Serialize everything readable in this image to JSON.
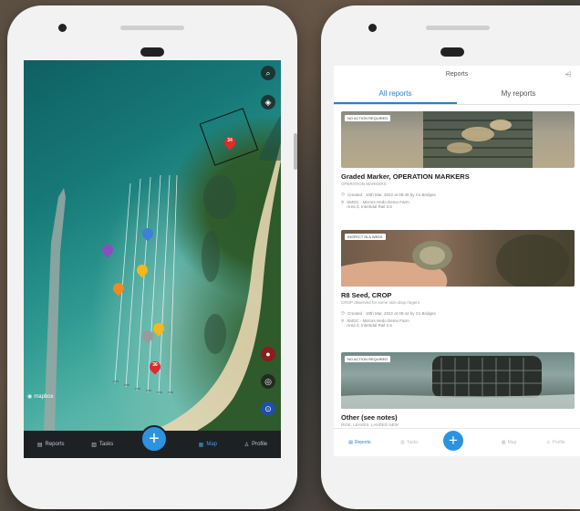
{
  "left_phone": {
    "tabs": [
      {
        "label": "Reports",
        "icon": "document-icon",
        "active": false
      },
      {
        "label": "Tasks",
        "icon": "clipboard-icon",
        "active": false
      },
      {
        "label": "Map",
        "icon": "map-icon",
        "active": true
      },
      {
        "label": "Profile",
        "icon": "person-icon",
        "active": false
      }
    ],
    "fab_label": "+",
    "attribution": "mapbox",
    "pins": [
      {
        "label": "34",
        "color": "#e02b2b"
      },
      {
        "label": "",
        "color": "#8a4fbf"
      },
      {
        "label": "",
        "color": "#3f7fd6"
      },
      {
        "label": "",
        "color": "#f3b81a"
      },
      {
        "label": "",
        "color": "#f08a1e"
      },
      {
        "label": "",
        "color": "#f3b81a"
      },
      {
        "label": "",
        "color": "#9a9a9a"
      },
      {
        "label": "36",
        "color": "#e02b2b"
      }
    ]
  },
  "right_phone": {
    "header_title": "Reports",
    "tabs": [
      {
        "label": "All reports",
        "active": true
      },
      {
        "label": "My reports",
        "active": false
      }
    ],
    "reports": [
      {
        "badge": "NO ACTION REQUIRED",
        "title": "Graded Marker, OPERATION MARKERS",
        "subtitle": "OPERATION MARKERS",
        "created": "Created · 10th Mar, 2022 at 09:49 by Cs Bridges",
        "location_line1": "SMOC - Mirrors Hedo Demo Farm",
        "location_line2": "Area 3, Intertidal Rail 3.6"
      },
      {
        "badge": "INSPECT IN A WEEK",
        "title": "R8 Seed, CROP",
        "subtitle": "CROP observed for some size drop ringers",
        "created": "Created · 10th Mar, 2022 at 09:44 by Cs Bridges",
        "location_line1": "SMOC - Mirrors Hedo Demo Farm",
        "location_line2": "Area 3, Intertidal Rail 2.5"
      },
      {
        "badge": "NO ACTION REQUIRED",
        "title": "Other (see notes)",
        "subtitle": "RIDE, LEAVES, LANDED NEW",
        "created": "",
        "location_line1": "",
        "location_line2": ""
      }
    ],
    "bottom_tabs": [
      {
        "label": "Reports",
        "active": true
      },
      {
        "label": "Tasks",
        "active": false
      },
      {
        "label": "Map",
        "active": false
      },
      {
        "label": "Profile",
        "active": false
      }
    ],
    "fab_label": "+"
  }
}
